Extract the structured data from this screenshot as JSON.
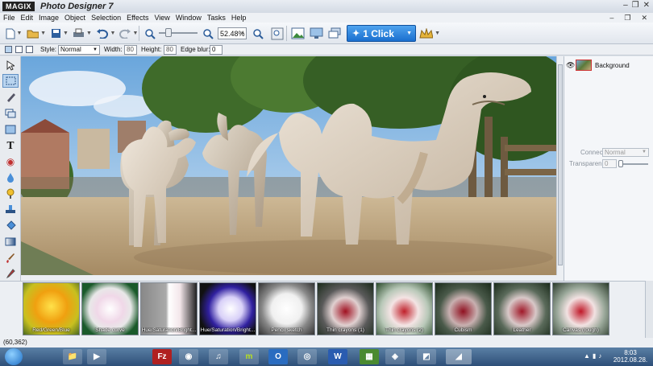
{
  "window": {
    "brand": "MAGIX",
    "title": "Photo Designer 7",
    "controls": [
      "–",
      "❐",
      "✕"
    ],
    "sub_controls": [
      "–",
      "❐",
      "✕"
    ]
  },
  "menu": [
    "File",
    "Edit",
    "Image",
    "Object",
    "Selection",
    "Effects",
    "View",
    "Window",
    "Tasks",
    "Help"
  ],
  "toolbar": {
    "zoom_value": "52.48%",
    "one_click_label": "1 Click"
  },
  "options": {
    "style_label": "Style:",
    "style_value": "Normal",
    "width_label": "Width:",
    "width_value": "80",
    "height_label": "Height:",
    "height_value": "80",
    "edge_blur_label": "Edge blur:",
    "edge_blur_value": "0"
  },
  "layers": {
    "items": [
      {
        "name": "Background"
      }
    ],
    "connect_label": "Connect:",
    "connect_value": "Normal",
    "transparency_label": "Transparency:",
    "transparency_value": "0"
  },
  "effects": [
    {
      "label": "Red/Green/Blue"
    },
    {
      "label": "Shade curve"
    },
    {
      "label": "Hue/Saturation/Bright..."
    },
    {
      "label": "Hue/Saturation/Bright..."
    },
    {
      "label": "Pencil sketch"
    },
    {
      "label": "Thin crayons (1)"
    },
    {
      "label": "Thin crayons (2)"
    },
    {
      "label": "Cubism"
    },
    {
      "label": "Leather"
    },
    {
      "label": "Canvas (rough)"
    }
  ],
  "status": {
    "coords": "(60,362)"
  },
  "taskbar": {
    "apps": [
      "📁",
      "▶",
      "Fz",
      "◉",
      "♫",
      "m",
      "O",
      "◎",
      "W",
      "▦",
      "◈",
      "◩",
      "◢"
    ],
    "time": "8:03",
    "date": "2012.08.28."
  },
  "colors": {
    "accent": "#1a6fcf",
    "selection": "#b9d4ef"
  }
}
